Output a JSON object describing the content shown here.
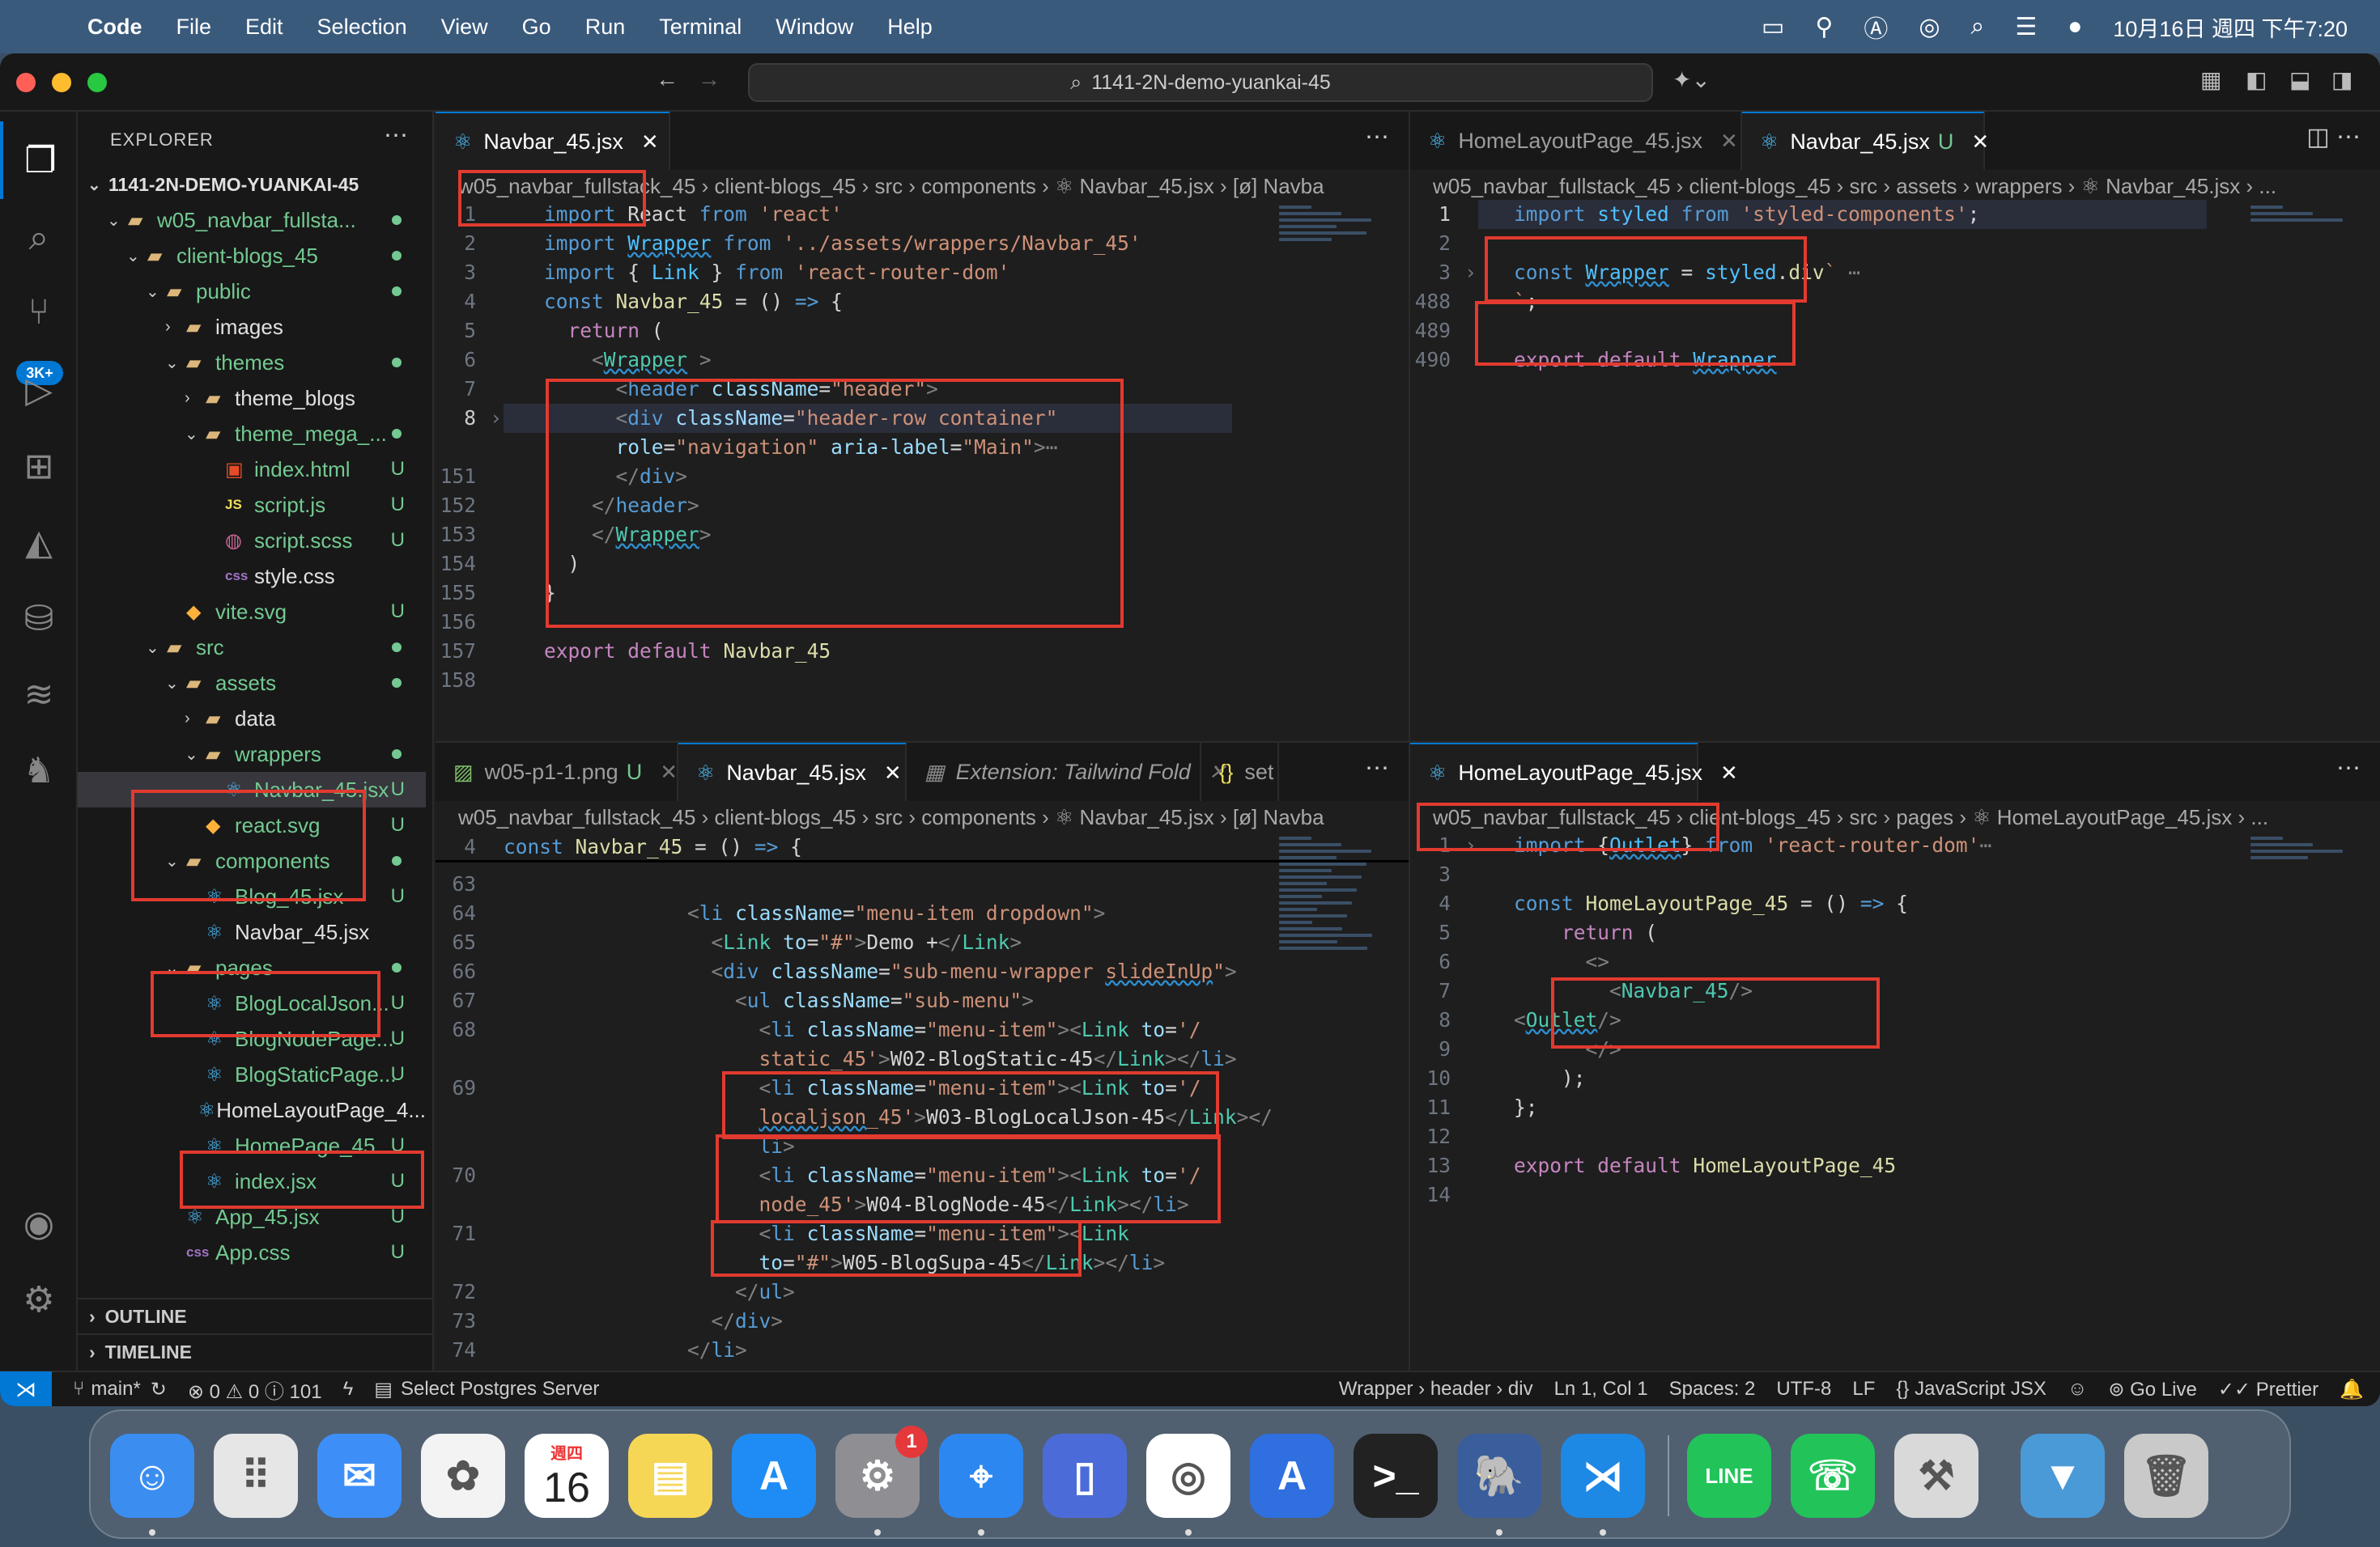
{
  "menubar": {
    "app": "Code",
    "items": [
      "File",
      "Edit",
      "Selection",
      "View",
      "Go",
      "Run",
      "Terminal",
      "Window",
      "Help"
    ],
    "datetime": "10月16日 週四 下午7:20"
  },
  "window": {
    "command_center": "1141-2N-demo-yuankai-45"
  },
  "activity": {
    "badge": "3K+"
  },
  "explorer": {
    "title": "EXPLORER",
    "root": "1141-2N-DEMO-YUANKAI-45",
    "tree": [
      {
        "label": "w05_navbar_fullsta...",
        "depth": 1,
        "chev": "⌄",
        "icon": "folder",
        "color": "g",
        "status": "dot"
      },
      {
        "label": "client-blogs_45",
        "depth": 2,
        "chev": "⌄",
        "icon": "folder",
        "color": "g",
        "status": "dot"
      },
      {
        "label": "public",
        "depth": 3,
        "chev": "⌄",
        "icon": "folder",
        "color": "g",
        "status": "dot"
      },
      {
        "label": "images",
        "depth": 4,
        "chev": "›",
        "icon": "folder",
        "color": "",
        "status": ""
      },
      {
        "label": "themes",
        "depth": 4,
        "chev": "⌄",
        "icon": "folder",
        "color": "g",
        "status": "dot"
      },
      {
        "label": "theme_blogs",
        "depth": 5,
        "chev": "›",
        "icon": "folder",
        "color": "",
        "status": ""
      },
      {
        "label": "theme_mega_...",
        "depth": 5,
        "chev": "⌄",
        "icon": "folder",
        "color": "g",
        "status": "dot"
      },
      {
        "label": "index.html",
        "depth": 6,
        "chev": "",
        "icon": "html",
        "color": "g",
        "status": "U"
      },
      {
        "label": "script.js",
        "depth": 6,
        "chev": "",
        "icon": "js",
        "color": "g",
        "status": "U"
      },
      {
        "label": "script.scss",
        "depth": 6,
        "chev": "",
        "icon": "scss",
        "color": "g",
        "status": "U"
      },
      {
        "label": "style.css",
        "depth": 6,
        "chev": "",
        "icon": "css",
        "color": "",
        "status": ""
      },
      {
        "label": "vite.svg",
        "depth": 4,
        "chev": "",
        "icon": "svg",
        "color": "g",
        "status": "U"
      },
      {
        "label": "src",
        "depth": 3,
        "chev": "⌄",
        "icon": "folder",
        "color": "g",
        "status": "dot"
      },
      {
        "label": "assets",
        "depth": 4,
        "chev": "⌄",
        "icon": "folder",
        "color": "g",
        "status": "dot"
      },
      {
        "label": "data",
        "depth": 5,
        "chev": "›",
        "icon": "folder",
        "color": "",
        "status": ""
      },
      {
        "label": "wrappers",
        "depth": 5,
        "chev": "⌄",
        "icon": "folder",
        "color": "g",
        "status": "dot"
      },
      {
        "label": "Navbar_45.jsx",
        "depth": 6,
        "chev": "",
        "icon": "react",
        "color": "g",
        "status": "U",
        "selected": true
      },
      {
        "label": "react.svg",
        "depth": 5,
        "chev": "",
        "icon": "svg",
        "color": "g",
        "status": "U"
      },
      {
        "label": "components",
        "depth": 4,
        "chev": "⌄",
        "icon": "folder",
        "color": "g",
        "status": "dot"
      },
      {
        "label": "Blog_45.jsx",
        "depth": 5,
        "chev": "",
        "icon": "react",
        "color": "g",
        "status": "U"
      },
      {
        "label": "Navbar_45.jsx",
        "depth": 5,
        "chev": "",
        "icon": "react",
        "color": "",
        "status": ""
      },
      {
        "label": "pages",
        "depth": 4,
        "chev": "⌄",
        "icon": "folder",
        "color": "g",
        "status": "dot"
      },
      {
        "label": "BlogLocalJson...",
        "depth": 5,
        "chev": "",
        "icon": "react",
        "color": "g",
        "status": "U"
      },
      {
        "label": "BlogNodePage...",
        "depth": 5,
        "chev": "",
        "icon": "react",
        "color": "g",
        "status": "U"
      },
      {
        "label": "BlogStaticPage...",
        "depth": 5,
        "chev": "",
        "icon": "react",
        "color": "g",
        "status": "U"
      },
      {
        "label": "HomeLayoutPage_4...",
        "depth": 5,
        "chev": "",
        "icon": "react",
        "color": "",
        "status": ""
      },
      {
        "label": "HomePage_45....",
        "depth": 5,
        "chev": "",
        "icon": "react",
        "color": "g",
        "status": "U"
      },
      {
        "label": "index.jsx",
        "depth": 5,
        "chev": "",
        "icon": "react",
        "color": "g",
        "status": "U"
      },
      {
        "label": "App_45.jsx",
        "depth": 4,
        "chev": "",
        "icon": "react",
        "color": "g",
        "status": "U"
      },
      {
        "label": "App.css",
        "depth": 4,
        "chev": "",
        "icon": "css",
        "color": "g",
        "status": "U"
      }
    ],
    "outline": "OUTLINE",
    "timeline": "TIMELINE"
  },
  "editors": {
    "tl": {
      "tabs": [
        {
          "label": "Navbar_45.jsx",
          "active": true
        }
      ],
      "breadcrumb": "w05_navbar_fullstack_45 › client-blogs_45 › src › components › ⚛ Navbar_45.jsx › [ø] Navba",
      "lines": [
        {
          "n": "1",
          "html": "<span class='k'>import</span> React <span class='k'>from</span> <span class='s'>'react'</span>"
        },
        {
          "n": "2",
          "html": "<span class='k'>import</span> <span class='v w'>Wrapper</span> <span class='k'>from</span> <span class='s'>'../assets/wrappers/Navbar_45'</span>"
        },
        {
          "n": "3",
          "html": "<span class='k'>import</span> { <span class='v'>Link</span> } <span class='k'>from</span> <span class='s'>'react-router-dom'</span>"
        },
        {
          "n": "4",
          "html": "<span class='k'>const</span> <span class='f'>Navbar_45</span> = () <span class='k'>=&gt;</span> {"
        },
        {
          "n": "5",
          "html": "  <span class='k2'>return</span> ("
        },
        {
          "n": "6",
          "html": "    <span class='p'>&lt;</span><span class='c w'>Wrapper</span> <span class='p'>&gt;</span>"
        },
        {
          "n": "7",
          "html": "      <span class='p'>&lt;</span><span class='t'>header</span> <span class='a'>className</span>=<span class='s'>\"header\"</span><span class='p'>&gt;</span>"
        },
        {
          "n": "8",
          "html": "      <span class='p'>&lt;</span><span class='t'>div</span> <span class='a'>className</span>=<span class='s'>\"header-row container\"</span>",
          "cur": true,
          "fold": true
        },
        {
          "n": "",
          "html": "      <span class='a'>role</span>=<span class='s'>\"navigation\"</span> <span class='a'>aria-label</span>=<span class='s'>\"Main\"</span><span class='p'>&gt;⋯</span>"
        },
        {
          "n": "151",
          "html": "      <span class='p'>&lt;/</span><span class='t'>div</span><span class='p'>&gt;</span>"
        },
        {
          "n": "152",
          "html": "    <span class='p'>&lt;/</span><span class='t'>header</span><span class='p'>&gt;</span>"
        },
        {
          "n": "153",
          "html": "    <span class='p'>&lt;/</span><span class='c w'>Wrapper</span><span class='p'>&gt;</span>"
        },
        {
          "n": "154",
          "html": "  )"
        },
        {
          "n": "155",
          "html": "}"
        },
        {
          "n": "156",
          "html": ""
        },
        {
          "n": "157",
          "html": "<span class='k2'>export</span> <span class='k2'>default</span> <span class='f'>Navbar_45</span>"
        },
        {
          "n": "158",
          "html": ""
        }
      ]
    },
    "tr": {
      "tabs": [
        {
          "label": "HomeLayoutPage_45.jsx",
          "active": false
        },
        {
          "label": "Navbar_45.jsx",
          "suffix": "U",
          "active": true
        }
      ],
      "breadcrumb": "w05_navbar_fullstack_45 › client-blogs_45 › src › assets › wrappers › ⚛ Navbar_45.jsx › ...",
      "lines": [
        {
          "n": "1",
          "html": "<span class='k'>import</span> <span class='v'>styled</span> <span class='k'>from</span> <span class='s'>'styled-components'</span>;",
          "cur": true
        },
        {
          "n": "2",
          "html": ""
        },
        {
          "n": "3",
          "html": "<span class='k'>const</span> <span class='v w'>Wrapper</span> = <span class='v'>styled</span>.<span class='f'>div</span><span class='s'>`</span> <span class='p'>⋯</span>",
          "fold": true
        },
        {
          "n": "488",
          "html": "<span class='s'>`</span>;"
        },
        {
          "n": "489",
          "html": ""
        },
        {
          "n": "490",
          "html": "<span class='k2'>export</span> <span class='k2'>default</span> <span class='v w'>Wrapper</span>"
        }
      ]
    },
    "bl": {
      "tabs": [
        {
          "label": "w05-p1-1.png",
          "suffix": "U",
          "active": false,
          "img": true
        },
        {
          "label": "Navbar_45.jsx",
          "active": true
        },
        {
          "label": "Extension: Tailwind Fold",
          "active": false,
          "italic": true
        },
        {
          "label": "set",
          "active": false,
          "braces": true
        }
      ],
      "breadcrumb": "w05_navbar_fullstack_45 › client-blogs_45 › src › components › ⚛ Navbar_45.jsx › [ø] Navba",
      "sticky": {
        "n": "4",
        "html": "<span class='k'>const</span> <span class='f'>Navbar_45</span> = () <span class='k'>=&gt;</span> {"
      },
      "lines": [
        {
          "n": "63",
          "html": ""
        },
        {
          "n": "64",
          "html": "            <span class='p'>&lt;</span><span class='t'>li</span> <span class='a'>className</span>=<span class='s'>\"menu-item dropdown\"</span><span class='p'>&gt;</span>"
        },
        {
          "n": "65",
          "html": "              <span class='p'>&lt;</span><span class='c'>Link</span> <span class='a'>to</span>=<span class='s'>\"#\"</span><span class='p'>&gt;</span>Demo +<span class='p'>&lt;/</span><span class='c'>Link</span><span class='p'>&gt;</span>"
        },
        {
          "n": "66",
          "html": "              <span class='p'>&lt;</span><span class='t'>div</span> <span class='a'>className</span>=<span class='s'>\"sub-menu-wrapper <span class='w'>slideInUp</span>\"</span><span class='p'>&gt;</span>"
        },
        {
          "n": "67",
          "html": "                <span class='p'>&lt;</span><span class='t'>ul</span> <span class='a'>className</span>=<span class='s'>\"sub-menu\"</span><span class='p'>&gt;</span>"
        },
        {
          "n": "68",
          "html": "                  <span class='p'>&lt;</span><span class='t'>li</span> <span class='a'>className</span>=<span class='s'>\"menu-item\"</span><span class='p'>&gt;&lt;</span><span class='c'>Link</span> <span class='a'>to</span>=<span class='s'>'/</span>"
        },
        {
          "n": "",
          "html": "                  <span class='s'>static_45'</span><span class='p'>&gt;</span>W02-BlogStatic-45<span class='p'>&lt;/</span><span class='c'>Link</span><span class='p'>&gt;&lt;/</span><span class='t'>li</span><span class='p'>&gt;</span>"
        },
        {
          "n": "69",
          "html": "                  <span class='p'>&lt;</span><span class='t'>li</span> <span class='a'>className</span>=<span class='s'>\"menu-item\"</span><span class='p'>&gt;&lt;</span><span class='c'>Link</span> <span class='a'>to</span>=<span class='s'>'/</span>"
        },
        {
          "n": "",
          "html": "                  <span class='s'><span class='w'>localjson</span>_45'</span><span class='p'>&gt;</span>W03-BlogLocalJson-45<span class='p'>&lt;/</span><span class='c'>Link</span><span class='p'>&gt;&lt;/</span>"
        },
        {
          "n": "",
          "html": "                  <span class='t'>li</span><span class='p'>&gt;</span>"
        },
        {
          "n": "70",
          "html": "                  <span class='p'>&lt;</span><span class='t'>li</span> <span class='a'>className</span>=<span class='s'>\"menu-item\"</span><span class='p'>&gt;&lt;</span><span class='c'>Link</span> <span class='a'>to</span>=<span class='s'>'/</span>"
        },
        {
          "n": "",
          "html": "                  <span class='s'>node_45'</span><span class='p'>&gt;</span>W04-BlogNode-45<span class='p'>&lt;/</span><span class='c'>Link</span><span class='p'>&gt;&lt;/</span><span class='t'>li</span><span class='p'>&gt;</span>"
        },
        {
          "n": "71",
          "html": "                  <span class='p'>&lt;</span><span class='t'>li</span> <span class='a'>className</span>=<span class='s'>\"menu-item\"</span><span class='p'>&gt;&lt;</span><span class='c'>Link</span>"
        },
        {
          "n": "",
          "html": "                  <span class='a'>to</span>=<span class='s'>\"#\"</span><span class='p'>&gt;</span>W05-BlogSupa-45<span class='p'>&lt;/</span><span class='c'>Link</span><span class='p'>&gt;&lt;/</span><span class='t'>li</span><span class='p'>&gt;</span>"
        },
        {
          "n": "72",
          "html": "                <span class='p'>&lt;/</span><span class='t'>ul</span><span class='p'>&gt;</span>"
        },
        {
          "n": "73",
          "html": "              <span class='p'>&lt;/</span><span class='t'>div</span><span class='p'>&gt;</span>"
        },
        {
          "n": "74",
          "html": "            <span class='p'>&lt;/</span><span class='t'>li</span><span class='p'>&gt;</span>"
        }
      ]
    },
    "br": {
      "tabs": [
        {
          "label": "HomeLayoutPage_45.jsx",
          "active": true
        }
      ],
      "breadcrumb": "w05_navbar_fullstack_45 › client-blogs_45 › src › pages › ⚛ HomeLayoutPage_45.jsx › ...",
      "lines": [
        {
          "n": "1",
          "html": "<span class='k'>import</span> {<span class='v w'>Outlet</span>} <span class='k'>from</span> <span class='s'>'react-router-dom'</span><span class='p'>⋯</span>",
          "fold": true
        },
        {
          "n": "3",
          "html": ""
        },
        {
          "n": "4",
          "html": "<span class='k'>const</span> <span class='f'>HomeLayoutPage_45</span> = () <span class='k'>=&gt;</span> {"
        },
        {
          "n": "5",
          "html": "    <span class='k2'>return</span> ("
        },
        {
          "n": "6",
          "html": "      <span class='p'>&lt;&gt;</span>"
        },
        {
          "n": "7",
          "html": "        <span class='p'>&lt;</span><span class='c'>Navbar_45</span><span class='p'>/&gt;</span>"
        },
        {
          "n": "8",
          "html": "<span class='p'>&lt;</span><span class='c w'>Outlet</span><span class='p'>/&gt;</span>"
        },
        {
          "n": "9",
          "html": "      <span class='p'>&lt;/&gt;</span>"
        },
        {
          "n": "10",
          "html": "    );"
        },
        {
          "n": "11",
          "html": "};"
        },
        {
          "n": "12",
          "html": ""
        },
        {
          "n": "13",
          "html": "<span class='k2'>export</span> <span class='k2'>default</span> <span class='f'>HomeLayoutPage_45</span>"
        },
        {
          "n": "14",
          "html": ""
        }
      ]
    }
  },
  "statusbar": {
    "branch": "main*",
    "problems": "⊗ 0 ⚠ 0 ⓘ 101",
    "db": "Select Postgres Server",
    "right": [
      "Wrapper › header › div",
      "Ln 1, Col 1",
      "Spaces: 2",
      "UTF-8",
      "LF",
      "{} JavaScript JSX",
      "Go Live",
      "Prettier"
    ]
  },
  "dock": {
    "calendar_day": "16",
    "calendar_week": "週四",
    "settings_badge": "1",
    "apps": [
      "Finder",
      "Launchpad",
      "Mail",
      "Photos",
      "Calendar",
      "Notes",
      "App Store",
      "System Settings",
      "Safari",
      "Simulator",
      "Chrome",
      "Xcode Instruments",
      "Terminal",
      "pgAdmin",
      "VS Code",
      "LINE",
      "Phone",
      "Automator",
      "Downloads",
      "Trash"
    ]
  }
}
